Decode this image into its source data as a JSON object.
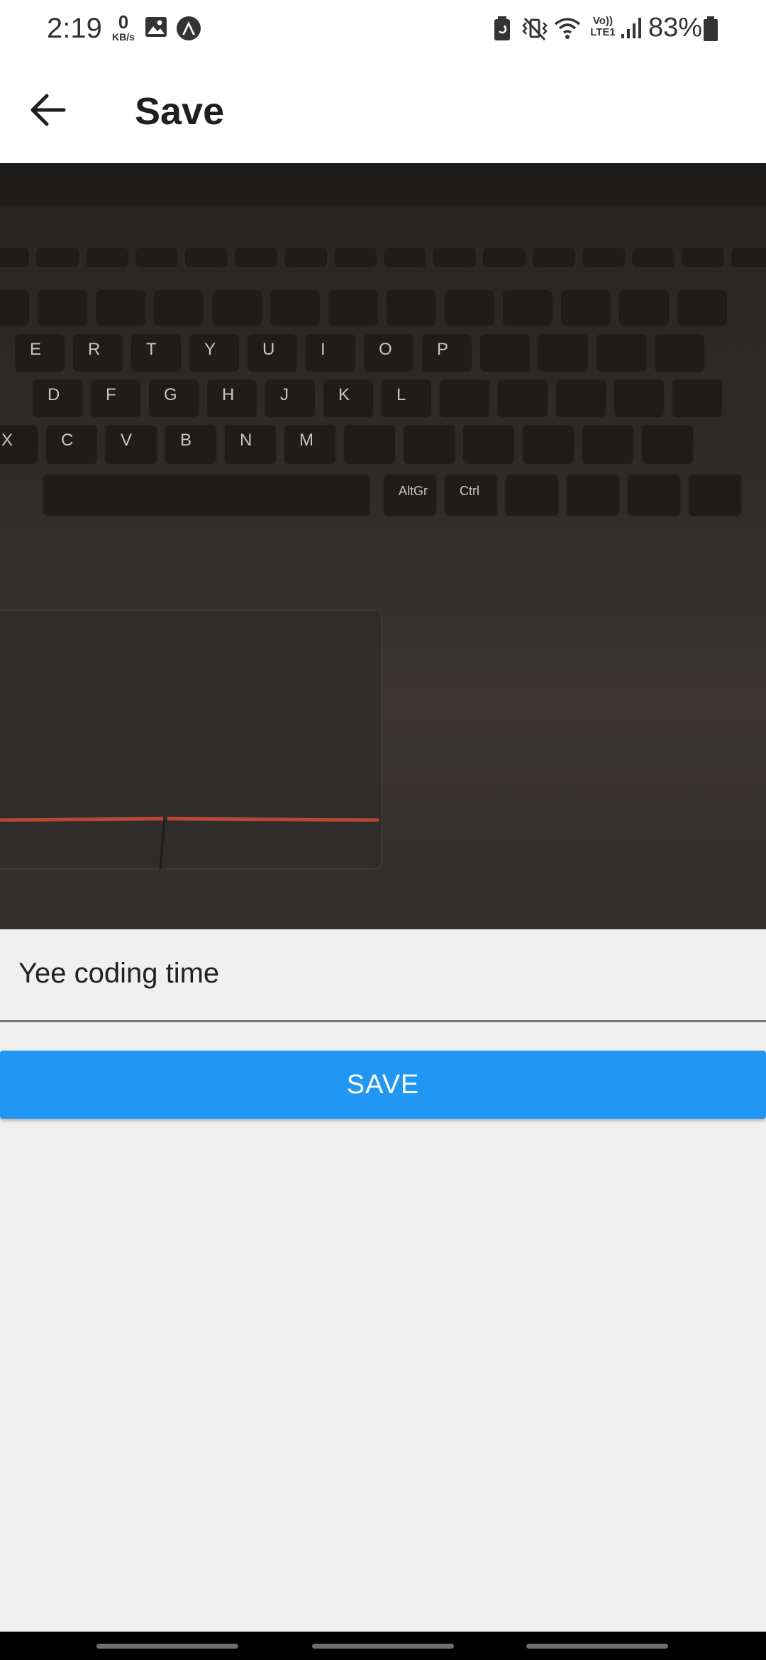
{
  "status_bar": {
    "time": "2:19",
    "net_speed_value": "0",
    "net_speed_unit": "KB/s",
    "network_label_top": "Vo))",
    "network_label_bottom": "LTE1",
    "battery_percent": "83%",
    "icons": [
      "gallery-icon",
      "expo-icon",
      "battery-saver-icon",
      "vibrate-icon",
      "wifi-icon",
      "signal-icon",
      "battery-icon"
    ]
  },
  "app_bar": {
    "title": "Save",
    "back_icon": "arrow-left-icon"
  },
  "photo": {
    "subject": "laptop-keyboard-photo",
    "key_labels": [
      "E",
      "R",
      "T",
      "Y",
      "U",
      "I",
      "O",
      "P",
      "D",
      "F",
      "G",
      "H",
      "J",
      "K",
      "L",
      "X",
      "C",
      "V",
      "B",
      "N",
      "M",
      "AltGr",
      "Ctrl"
    ]
  },
  "form": {
    "caption_value": "Yee coding time",
    "save_label": "SAVE"
  },
  "colors": {
    "accent": "#2196f3",
    "background": "#f0f0f0",
    "app_bar": "#ffffff"
  }
}
